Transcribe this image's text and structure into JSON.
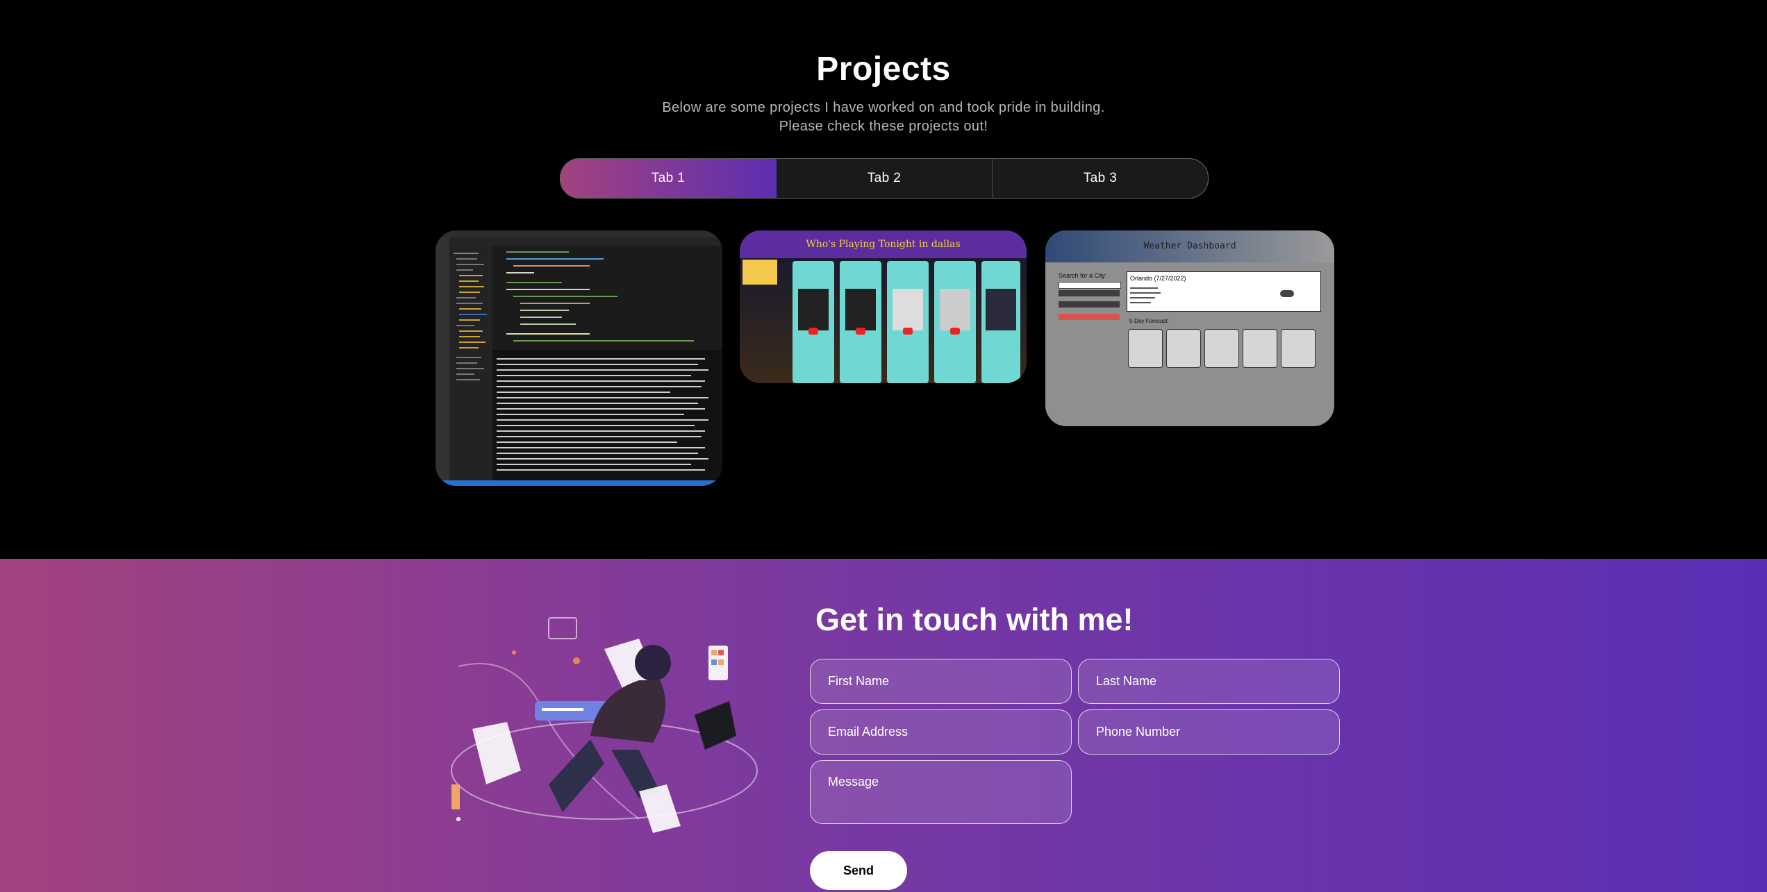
{
  "projects": {
    "title": "Projects",
    "subtitle": "Below are some projects I have worked on and took pride in building. Please check these projects out!",
    "tabs": [
      {
        "label": "Tab 1",
        "active": true
      },
      {
        "label": "Tab 2",
        "active": false
      },
      {
        "label": "Tab 3",
        "active": false
      }
    ],
    "cards": [
      {
        "name": "code-editor-screenshot"
      },
      {
        "name": "concerts-app-screenshot",
        "heading": "Who's Playing Tonight in dallas"
      },
      {
        "name": "weather-dashboard-screenshot",
        "heading": "Weather Dashboard",
        "search_label": "Search for a City:",
        "city": "Orlando (7/27/2022)",
        "forecast_label": "5-Day Forecast:"
      }
    ]
  },
  "contact": {
    "title": "Get in touch with me!",
    "first_name_placeholder": "First Name",
    "last_name_placeholder": "Last Name",
    "email_placeholder": "Email Address",
    "phone_placeholder": "Phone Number",
    "message_placeholder": "Message",
    "send_label": "Send"
  },
  "colors": {
    "gradient_start": "#a3427f",
    "gradient_end": "#5a2fb5",
    "background": "#000000"
  }
}
